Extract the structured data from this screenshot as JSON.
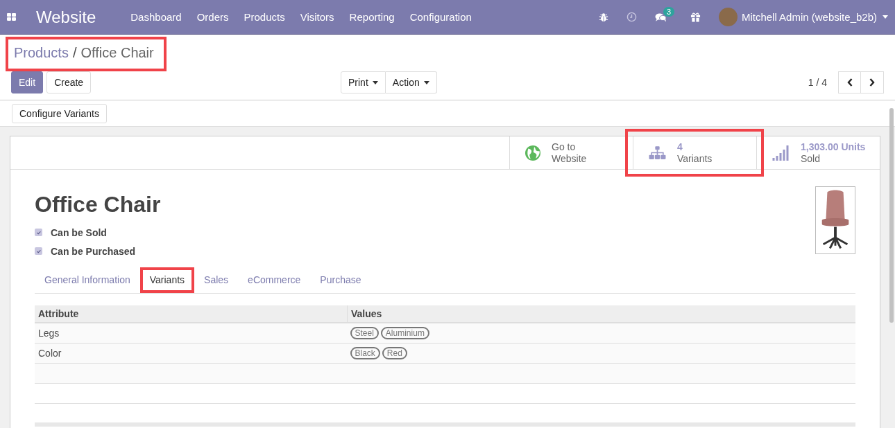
{
  "navbar": {
    "app_name": "Website",
    "menu": [
      "Dashboard",
      "Orders",
      "Products",
      "Visitors",
      "Reporting",
      "Configuration"
    ],
    "messages_count": "3",
    "user": "Mitchell Admin (website_b2b)"
  },
  "breadcrumb": {
    "parent": "Products",
    "separator": "/",
    "current": "Office Chair",
    "highlighted": true
  },
  "buttons": {
    "edit": "Edit",
    "create": "Create",
    "print": "Print",
    "action": "Action"
  },
  "pager": {
    "value": "1 / 4"
  },
  "configure_button": "Configure Variants",
  "stat_buttons": [
    {
      "kind": "website",
      "line1": "Go to",
      "line2": "Website",
      "highlighted": false
    },
    {
      "kind": "variants",
      "line1": "4",
      "line2": "Variants",
      "highlighted": true
    },
    {
      "kind": "sold",
      "line1": "1,303.00 Units",
      "line2": "Sold",
      "highlighted": false
    }
  ],
  "product": {
    "name": "Office Chair",
    "checkboxes": [
      {
        "label": "Can be Sold",
        "checked": true
      },
      {
        "label": "Can be Purchased",
        "checked": true
      }
    ]
  },
  "tabs": [
    {
      "label": "General Information",
      "selected": false,
      "highlighted": false
    },
    {
      "label": "Variants",
      "selected": true,
      "highlighted": true
    },
    {
      "label": "Sales",
      "selected": false,
      "highlighted": false
    },
    {
      "label": "eCommerce",
      "selected": false,
      "highlighted": false
    },
    {
      "label": "Purchase",
      "selected": false,
      "highlighted": false
    }
  ],
  "table": {
    "columns": [
      "Attribute",
      "Values"
    ],
    "rows": [
      {
        "attribute": "Legs",
        "values": [
          "Steel",
          "Aluminium"
        ]
      },
      {
        "attribute": "Color",
        "values": [
          "Black",
          "Red"
        ]
      }
    ]
  }
}
